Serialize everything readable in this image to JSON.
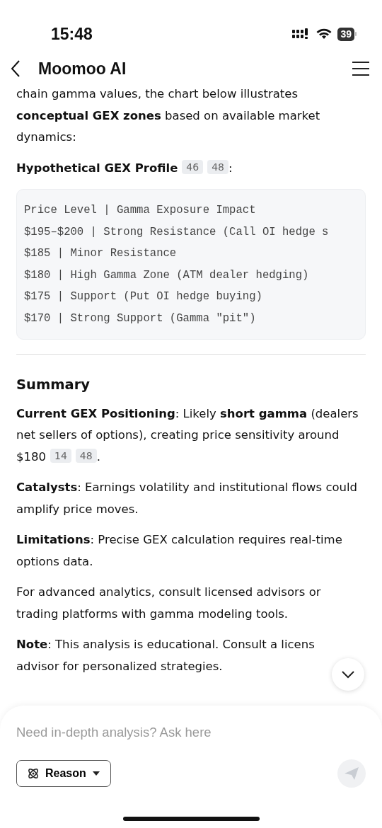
{
  "status_bar": {
    "time": "15:48",
    "battery": "39"
  },
  "header": {
    "title": "Moomoo AI"
  },
  "content": [
    {
      "kind": "paragraph",
      "text": "chain gamma values, the chart below illustrates **conceptual GEX zones** based on available market dynamics:"
    },
    {
      "kind": "subheading",
      "text": "Hypothetical GEX Profile",
      "citations": [
        "46",
        "48"
      ],
      "suffix": ":"
    },
    {
      "kind": "code",
      "lines": [
        "Price Level | Gamma Exposure Impact",
        "$195–$200 | Strong Resistance (Call OI hedge s",
        "$185 | Minor Resistance",
        "$180 | High Gamma Zone (ATM dealer hedging)",
        "$175 | Support (Put OI hedge buying)",
        "$170 | Strong Support (Gamma \"pit\")"
      ]
    },
    {
      "kind": "divider"
    },
    {
      "kind": "heading",
      "text": "Summary"
    },
    {
      "kind": "paragraph",
      "text": "**Current GEX Positioning**: Likely **short gamma** (dealers net sellers of options), creating price sensitivity around",
      "last_line": "$180",
      "citations": [
        "14",
        "48"
      ],
      "suffix": "."
    },
    {
      "kind": "paragraph",
      "text": "**Catalysts**: Earnings volatility and institutional flows could amplify price moves."
    },
    {
      "kind": "paragraph",
      "text": "**Limitations**: Precise GEX calculation requires real-time options data."
    },
    {
      "kind": "paragraph",
      "text": "For advanced analytics, consult licensed advisors or trading platforms with gamma modeling tools."
    },
    {
      "kind": "paragraph",
      "lines": [
        "**Note**: This analysis is educational. Consult a licens",
        "advisor for personalized strategies."
      ]
    }
  ],
  "composer": {
    "placeholder": "Need in-depth analysis? Ask here",
    "mode_button": "Reason"
  }
}
